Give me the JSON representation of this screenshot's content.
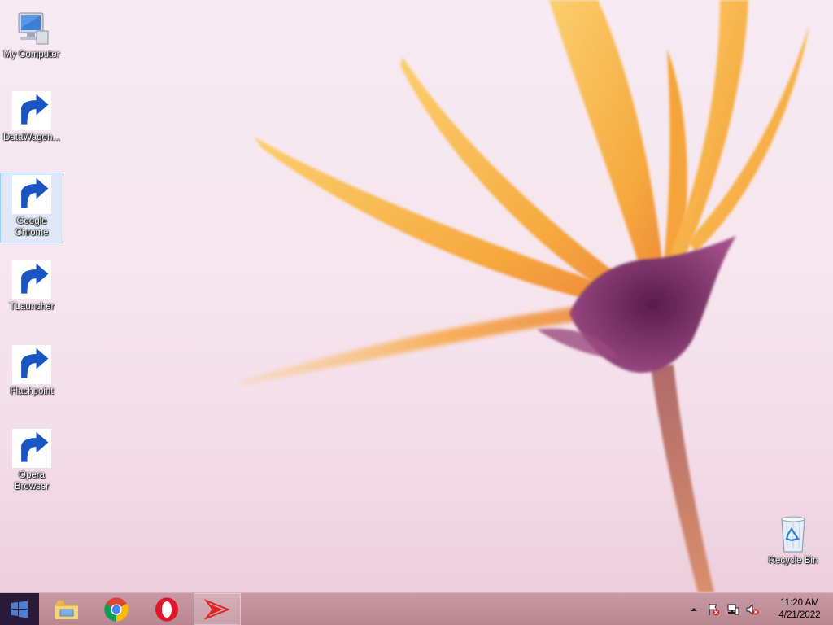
{
  "desktop": {
    "icons": [
      {
        "label": "My Computer",
        "icon": "computer-icon"
      },
      {
        "label": "DataWagon...",
        "icon": "datawagon-icon"
      },
      {
        "label": "Google\nChrome",
        "icon": "chrome-icon"
      },
      {
        "label": "TLauncher",
        "icon": "tlauncher-icon"
      },
      {
        "label": "Flashpoint",
        "icon": "flashpoint-icon"
      },
      {
        "label": "Opera\nBrowser",
        "icon": "opera-icon"
      }
    ],
    "recycle_bin": {
      "label": "Recycle Bin",
      "icon": "recycle-bin-icon"
    },
    "selected_icon": "Google Chrome"
  },
  "taskbar": {
    "start": {
      "icon": "windows-logo-icon"
    },
    "pinned": [
      {
        "name": "File Explorer",
        "icon": "folder-icon"
      },
      {
        "name": "Google Chrome",
        "icon": "chrome-icon"
      },
      {
        "name": "Opera Browser",
        "icon": "opera-icon"
      },
      {
        "name": "Flashpoint",
        "icon": "flashpoint-icon",
        "active": true
      }
    ],
    "tray": {
      "icons": [
        "show-hidden-icons-chevron",
        "action-center-flag-icon",
        "network-icon",
        "volume-muted-icon"
      ],
      "time": "11:20 AM",
      "date": "4/21/2022"
    }
  },
  "colors": {
    "taskbar": "#c1909b",
    "start_button": "#2a1a3a",
    "windows_logo": "#4a7fd4",
    "petal": "#f7b84a",
    "petal_center": "#7a2e6a"
  }
}
